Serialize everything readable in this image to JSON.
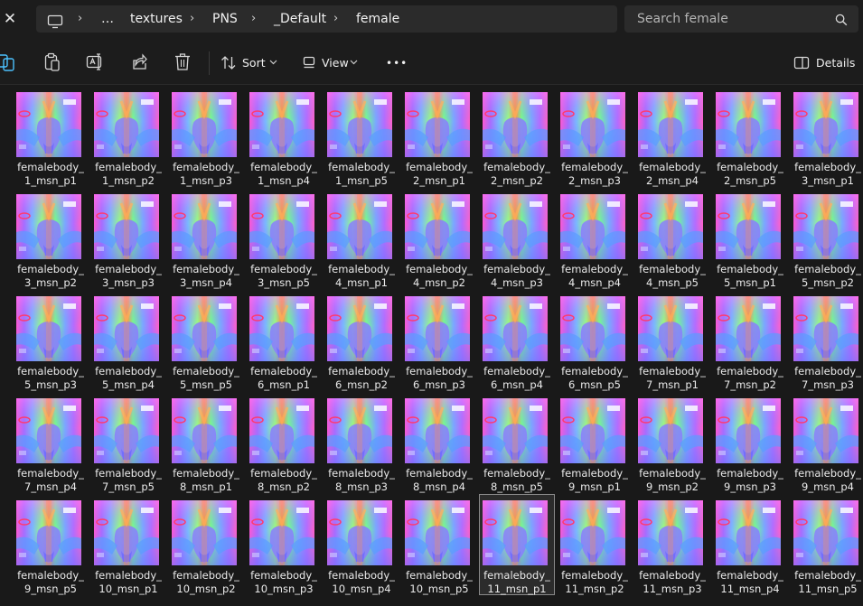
{
  "window": {
    "close_glyph": "✕"
  },
  "address_bar": {
    "segments": [
      "…",
      "textures",
      "PNS",
      "_Default",
      "female"
    ],
    "separator": "›",
    "icons": [
      "computer-icon",
      "chevron-right-icon"
    ]
  },
  "search": {
    "placeholder": "Search female"
  },
  "command_bar": {
    "sort_label": "Sort",
    "view_label": "View",
    "more_label": "•••",
    "details_label": "Details"
  },
  "files": [
    {
      "line1": "femalebody_",
      "line2": "1_msn_p1"
    },
    {
      "line1": "femalebody_",
      "line2": "1_msn_p2"
    },
    {
      "line1": "femalebody_",
      "line2": "1_msn_p3"
    },
    {
      "line1": "femalebody_",
      "line2": "1_msn_p4"
    },
    {
      "line1": "femalebody_",
      "line2": "1_msn_p5"
    },
    {
      "line1": "femalebody_",
      "line2": "2_msn_p1"
    },
    {
      "line1": "femalebody_",
      "line2": "2_msn_p2"
    },
    {
      "line1": "femalebody_",
      "line2": "2_msn_p3"
    },
    {
      "line1": "femalebody_",
      "line2": "2_msn_p4"
    },
    {
      "line1": "femalebody_",
      "line2": "2_msn_p5"
    },
    {
      "line1": "femalebody_",
      "line2": "3_msn_p1"
    },
    {
      "line1": "femalebody_",
      "line2": "3_msn_p2"
    },
    {
      "line1": "femalebody_",
      "line2": "3_msn_p3"
    },
    {
      "line1": "femalebody_",
      "line2": "3_msn_p4"
    },
    {
      "line1": "femalebody_",
      "line2": "3_msn_p5"
    },
    {
      "line1": "femalebody_",
      "line2": "4_msn_p1"
    },
    {
      "line1": "femalebody_",
      "line2": "4_msn_p2"
    },
    {
      "line1": "femalebody_",
      "line2": "4_msn_p3"
    },
    {
      "line1": "femalebody_",
      "line2": "4_msn_p4"
    },
    {
      "line1": "femalebody_",
      "line2": "4_msn_p5"
    },
    {
      "line1": "femalebody_",
      "line2": "5_msn_p1"
    },
    {
      "line1": "femalebody_",
      "line2": "5_msn_p2"
    },
    {
      "line1": "femalebody_",
      "line2": "5_msn_p3"
    },
    {
      "line1": "femalebody_",
      "line2": "5_msn_p4"
    },
    {
      "line1": "femalebody_",
      "line2": "5_msn_p5"
    },
    {
      "line1": "femalebody_",
      "line2": "6_msn_p1"
    },
    {
      "line1": "femalebody_",
      "line2": "6_msn_p2"
    },
    {
      "line1": "femalebody_",
      "line2": "6_msn_p3"
    },
    {
      "line1": "femalebody_",
      "line2": "6_msn_p4"
    },
    {
      "line1": "femalebody_",
      "line2": "6_msn_p5"
    },
    {
      "line1": "femalebody_",
      "line2": "7_msn_p1"
    },
    {
      "line1": "femalebody_",
      "line2": "7_msn_p2"
    },
    {
      "line1": "femalebody_",
      "line2": "7_msn_p3"
    },
    {
      "line1": "femalebody_",
      "line2": "7_msn_p4"
    },
    {
      "line1": "femalebody_",
      "line2": "7_msn_p5"
    },
    {
      "line1": "femalebody_",
      "line2": "8_msn_p1"
    },
    {
      "line1": "femalebody_",
      "line2": "8_msn_p2"
    },
    {
      "line1": "femalebody_",
      "line2": "8_msn_p3"
    },
    {
      "line1": "femalebody_",
      "line2": "8_msn_p4"
    },
    {
      "line1": "femalebody_",
      "line2": "8_msn_p5"
    },
    {
      "line1": "femalebody_",
      "line2": "9_msn_p1"
    },
    {
      "line1": "femalebody_",
      "line2": "9_msn_p2"
    },
    {
      "line1": "femalebody_",
      "line2": "9_msn_p3"
    },
    {
      "line1": "femalebody_",
      "line2": "9_msn_p4"
    },
    {
      "line1": "femalebody_",
      "line2": "9_msn_p5"
    },
    {
      "line1": "femalebody_",
      "line2": "10_msn_p1"
    },
    {
      "line1": "femalebody_",
      "line2": "10_msn_p2"
    },
    {
      "line1": "femalebody_",
      "line2": "10_msn_p3"
    },
    {
      "line1": "femalebody_",
      "line2": "10_msn_p4"
    },
    {
      "line1": "femalebody_",
      "line2": "10_msn_p5"
    },
    {
      "line1": "femalebody_",
      "line2": "11_msn_p1",
      "selected": true
    },
    {
      "line1": "femalebody_",
      "line2": "11_msn_p2"
    },
    {
      "line1": "femalebody_",
      "line2": "11_msn_p3"
    },
    {
      "line1": "femalebody_",
      "line2": "11_msn_p4"
    },
    {
      "line1": "femalebody_",
      "line2": "11_msn_p5"
    }
  ],
  "colors": {
    "background": "#191919",
    "chrome": "#1c1c1c",
    "field": "#2b2b2b",
    "text": "#f0f0f0",
    "accent": "#4cc2ff",
    "normal_map_base": "#8080ff"
  }
}
